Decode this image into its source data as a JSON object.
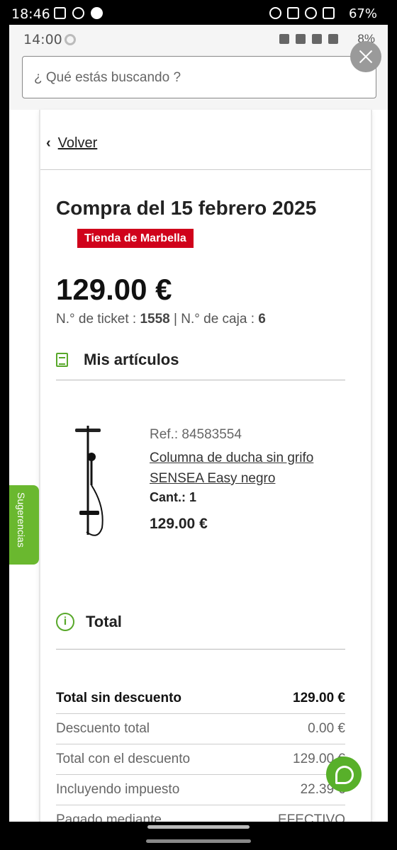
{
  "outer_status": {
    "time": "18:46",
    "battery": "67%"
  },
  "inner_status": {
    "time": "14:00",
    "battery": "8%"
  },
  "search": {
    "placeholder": "¿ Qué estás buscando ?"
  },
  "back": {
    "label": "Volver"
  },
  "purchase": {
    "title": "Compra del 15 febrero 2025",
    "store": "Tienda de Marbella",
    "total_price": "129.00 €",
    "ticket_label": "N.° de ticket : ",
    "ticket_number": "1558",
    "separator": " | ",
    "register_label": "N.° de caja : ",
    "register_number": "6"
  },
  "articles": {
    "heading": "Mis artículos",
    "items": [
      {
        "ref": "Ref.: 84583554",
        "name": "Columna de ducha sin grifo SENSEA Easy negro",
        "qty_label": "Cant.: ",
        "qty": "1",
        "price": "129.00 €"
      }
    ]
  },
  "suggestions_tab": "Sugerencias",
  "totals": {
    "heading": "Total",
    "rows": [
      {
        "label": "Total sin descuento",
        "value": "129.00 €"
      },
      {
        "label": "Descuento total",
        "value": "0.00 €"
      },
      {
        "label": "Total con el descuento",
        "value": "129.00 €"
      },
      {
        "label": "Incluyendo impuesto",
        "value": "22.39 €"
      },
      {
        "label": "Pagado mediante",
        "value": "EFECTIVO"
      }
    ]
  },
  "colors": {
    "brand_green": "#58a82a",
    "store_red": "#d0021b"
  },
  "icons": [
    "close-icon",
    "document-icon",
    "info-icon",
    "chat-icon",
    "back-chevron-icon"
  ]
}
